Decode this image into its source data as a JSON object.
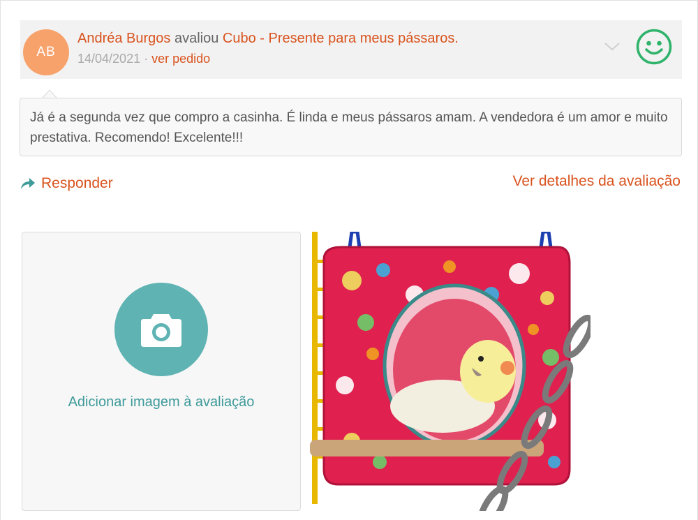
{
  "review": {
    "avatar_initials": "AB",
    "reviewer_name": "Andréa Burgos",
    "action_text": " avaliou ",
    "product_name": "Cubo - Presente para meus pássaros.",
    "date": "14/04/2021",
    "separator": " · ",
    "order_link": "ver pedido",
    "rating_icon": "happy-face-icon",
    "comment": "Já é a segunda vez que compro a casinha. É linda e meus pássaros amam. A vendedora é um amor e muito prestativa. Recomendo! Excelente!!!"
  },
  "actions": {
    "reply_label": "Responder",
    "details_label": "Ver detalhes da avaliação"
  },
  "upload": {
    "label": "Adicionar imagem à avaliação",
    "icon": "camera-icon"
  },
  "colors": {
    "accent": "#d9531e",
    "avatar": "#f7a26b",
    "teal": "#5fb3b3",
    "smiley": "#2fb36b"
  }
}
